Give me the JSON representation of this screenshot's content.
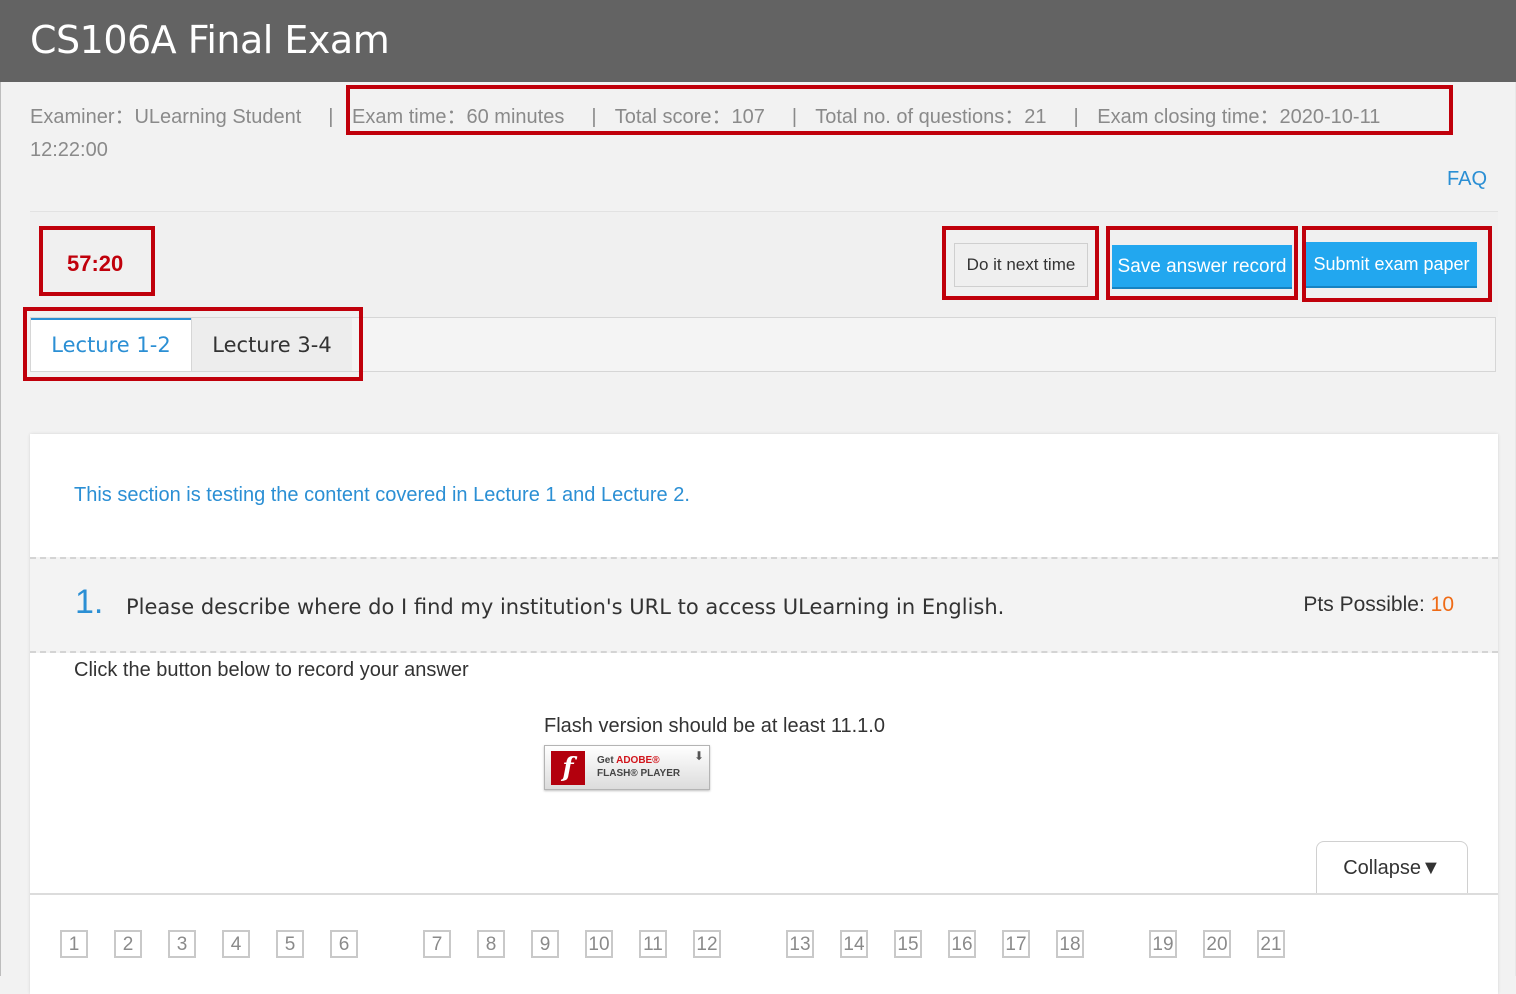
{
  "header": {
    "title": "CS106A Final Exam"
  },
  "info": {
    "examiner": "Examiner：ULearning Student",
    "separator": "|",
    "exam_time": "Exam time：60 minutes",
    "total_score": "Total score：107",
    "total_questions": "Total no. of questions：21",
    "closing_time": "Exam closing time：2020-10-11 12:22:00"
  },
  "faq": "FAQ",
  "timer": "57:20",
  "toolbar": {
    "do_next_time": "Do it next time",
    "save_record": "Save answer record",
    "submit": "Submit exam paper"
  },
  "tabs": [
    {
      "label": "Lecture 1-2",
      "active": true
    },
    {
      "label": "Lecture 3-4",
      "active": false
    }
  ],
  "section_note": "This section is testing the content covered in Lecture 1 and Lecture 2.",
  "question": {
    "number": "1.",
    "text": "Please describe where do I find my institution's URL to access ULearning in English.",
    "pts_label": "Pts Possible:",
    "pts_value": "10",
    "instruction": "Click the button below to record your answer",
    "flash_note": "Flash version should be at least 11.1.0",
    "flash_badge_line1_a": "Get",
    "flash_badge_line1_b": "ADOBE®",
    "flash_badge_line2": "FLASH® PLAYER"
  },
  "collapse": "Collapse▼",
  "question_nav": [
    "1",
    "2",
    "3",
    "4",
    "5",
    "6",
    "7",
    "8",
    "9",
    "10",
    "11",
    "12",
    "13",
    "14",
    "15",
    "16",
    "17",
    "18",
    "19",
    "20",
    "21"
  ],
  "colors": {
    "accent_blue": "#2b8fd4",
    "button_blue": "#22a7ef",
    "timer_red": "#c0000b",
    "points_orange": "#ef6b16",
    "header_gray": "#636363"
  }
}
